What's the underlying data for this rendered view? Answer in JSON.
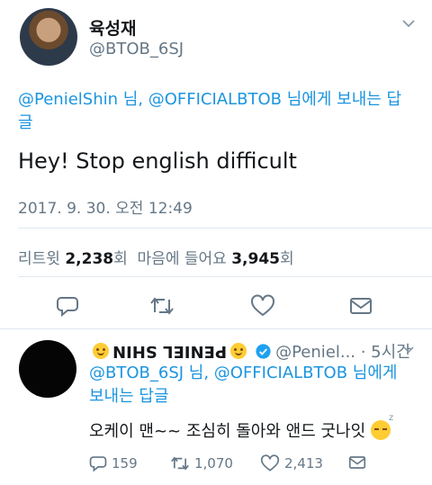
{
  "tweet": {
    "display_name": "육성재",
    "handle": "@BTOB_6SJ",
    "reply_mention_1": "@PenielShin",
    "reply_sep_1": " 님, ",
    "reply_mention_2": "@OFFICIALBTOB",
    "reply_suffix": " 님에게 보내는 답글",
    "text": "Hey! Stop english difficult",
    "timestamp": "2017. 9. 30. 오전 12:49",
    "stats": {
      "retweets_label": "리트윗 ",
      "retweets_count": "2,238",
      "retweets_unit": "회",
      "likes_label": "  마음에 들어요 ",
      "likes_count": "3,945",
      "likes_unit": "회"
    },
    "actions": [
      "reply-icon",
      "retweet-icon",
      "like-icon",
      "message-icon"
    ]
  },
  "reply": {
    "display_name": "PENIEL SHIN",
    "handle_time": "@Peniel... · 5시간",
    "reply_mention_1": "@BTOB_6SJ",
    "reply_sep_1": " 님, ",
    "reply_mention_2": "@OFFICIALBTOB",
    "reply_suffix": " 님에게 보내는 답글",
    "text": "오케이 맨~~ 조심히 돌아와 앤드 굿나잇",
    "counts": {
      "replies": "159",
      "retweets": "1,070",
      "likes": "2,413"
    }
  },
  "colors": {
    "link": "#1b95e0",
    "secondary_text": "#657786",
    "verified": "#1da1f2"
  }
}
